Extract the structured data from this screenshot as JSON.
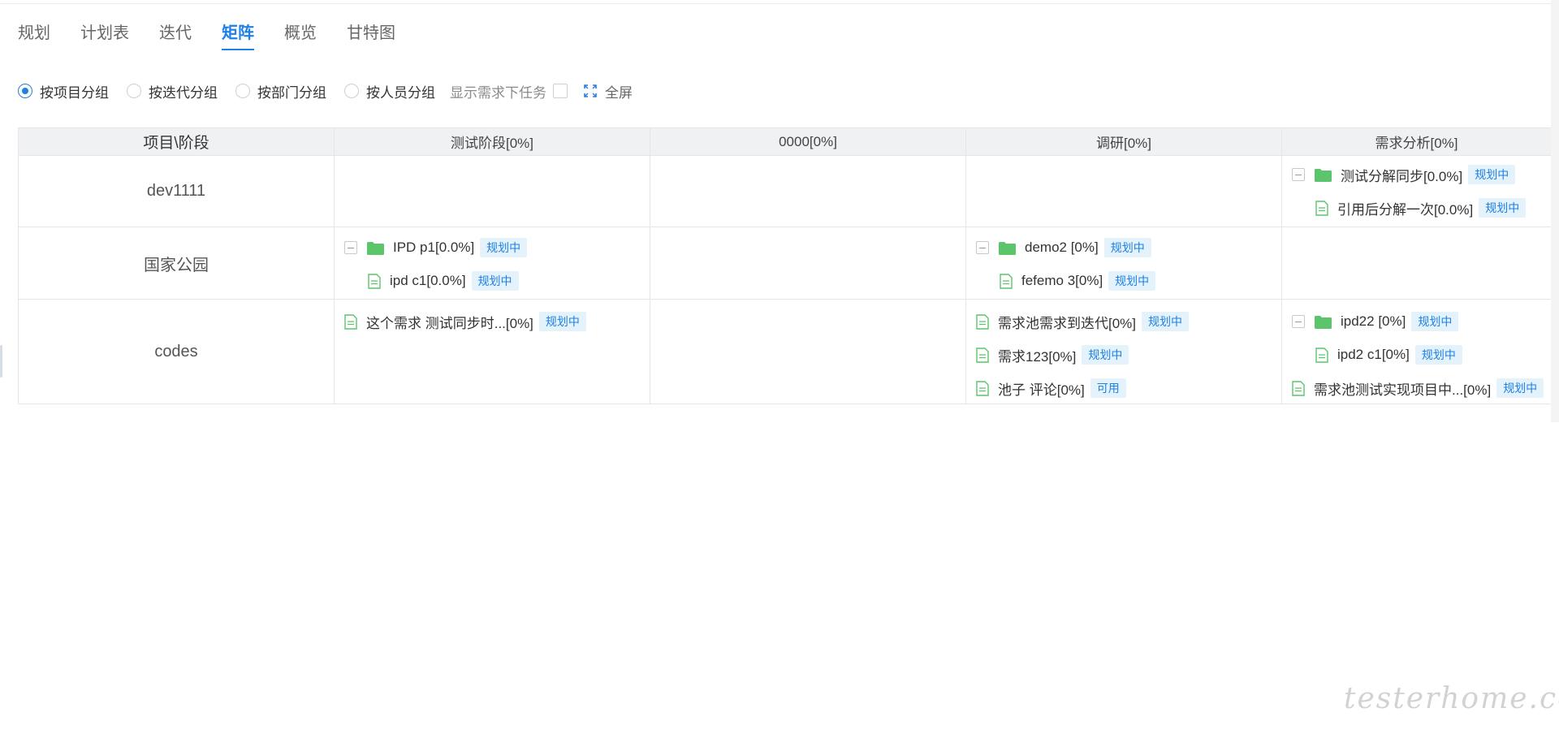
{
  "tabs": [
    {
      "label": "规划"
    },
    {
      "label": "计划表"
    },
    {
      "label": "迭代"
    },
    {
      "label": "矩阵",
      "active": true
    },
    {
      "label": "概览"
    },
    {
      "label": "甘特图"
    }
  ],
  "filters": {
    "group_options": [
      {
        "label": "按项目分组",
        "checked": true
      },
      {
        "label": "按迭代分组",
        "checked": false
      },
      {
        "label": "按部门分组",
        "checked": false
      },
      {
        "label": "按人员分组",
        "checked": false
      }
    ],
    "show_tasks_label": "显示需求下任务",
    "show_tasks_checked": false,
    "fullscreen_label": "全屏"
  },
  "matrix": {
    "corner_header": "项目\\阶段",
    "stage_headers": [
      "测试阶段[0%]",
      "0000[0%]",
      "调研[0%]",
      "需求分析[0%]"
    ],
    "rows": [
      {
        "project": "dev1111",
        "items": [
          {
            "text": "测试分解同步[0.0%]",
            "badge": "规划中",
            "kind": "folder"
          },
          {
            "text": "引用后分解一次[0.0%]",
            "badge": "规划中",
            "kind": "doc"
          }
        ]
      },
      {
        "project": "国家公园",
        "items": [
          {
            "text": "IPD p1[0.0%]",
            "badge": "规划中",
            "kind": "folder"
          },
          {
            "text": "ipd c1[0.0%]",
            "badge": "规划中",
            "kind": "doc"
          },
          {
            "text": "demo2 [0%]",
            "badge": "规划中",
            "kind": "folder"
          },
          {
            "text": "fefemo 3[0%]",
            "badge": "规划中",
            "kind": "doc"
          }
        ]
      },
      {
        "project": "codes",
        "items": [
          {
            "text": "这个需求 测试同步时...[0%]",
            "badge": "规划中",
            "kind": "doc"
          },
          {
            "text": "需求池需求到迭代[0%]",
            "badge": "规划中",
            "kind": "doc"
          },
          {
            "text": "需求123[0%]",
            "badge": "规划中",
            "kind": "doc"
          },
          {
            "text": "池子 评论[0%]",
            "badge": "可用",
            "kind": "doc"
          },
          {
            "text": "ipd22 [0%]",
            "badge": "规划中",
            "kind": "folder"
          },
          {
            "text": "ipd2 c1[0%]",
            "badge": "规划中",
            "kind": "doc"
          },
          {
            "text": "需求池测试实现项目中...[0%]",
            "badge": "规划中",
            "kind": "doc"
          }
        ]
      }
    ]
  },
  "watermark": "testerhome.com",
  "icons": {
    "folder": "folder-icon",
    "doc": "document-icon",
    "collapse": "collapse-minus-icon",
    "fullscreen": "fullscreen-icon"
  },
  "colors": {
    "accent": "#1e80e5",
    "icon_green": "#5cc46b",
    "badge_bg": "#e4f3fb",
    "header_bg": "#f0f1f3"
  }
}
